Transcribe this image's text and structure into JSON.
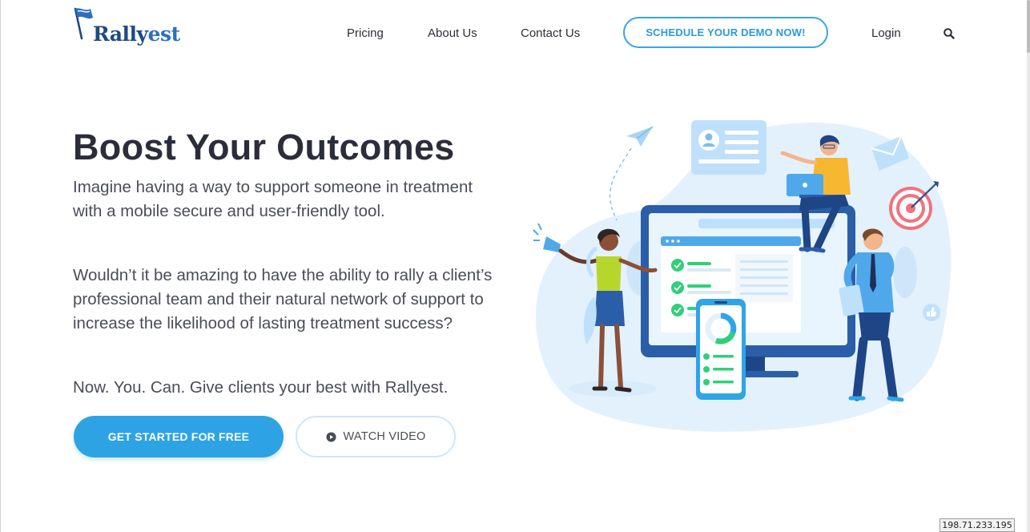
{
  "brand": {
    "name_prefix": "R",
    "name": "ally",
    "name_accent": "est",
    "logo_icon": "flag-icon"
  },
  "nav": {
    "pricing": "Pricing",
    "about": "About Us",
    "contact": "Contact Us",
    "demo": "SCHEDULE YOUR DEMO NOW!",
    "login": "Login",
    "search_icon": "search-icon"
  },
  "hero": {
    "title": "Boost Your Outcomes",
    "p1": "Imagine having a way to support someone in treatment with a mobile secure and user-friendly tool.",
    "p2": "Wouldn’t it be amazing to have the ability to rally a client’s professional team and their natural network of support to increase the likelihood of lasting treatment success?",
    "p3": "Now. You. Can. Give clients your best with Rallyest.",
    "cta_primary": "GET STARTED FOR FREE",
    "cta_secondary": "WATCH VIDEO",
    "play_icon": "play-icon"
  },
  "colors": {
    "accent": "#2ea3e3",
    "brand_dark": "#1d4a86",
    "heading": "#2b2d3a",
    "illustration_bg": "#e3f1fc",
    "check_green": "#2fd07a"
  },
  "ip_badge": "198.71.233.195"
}
